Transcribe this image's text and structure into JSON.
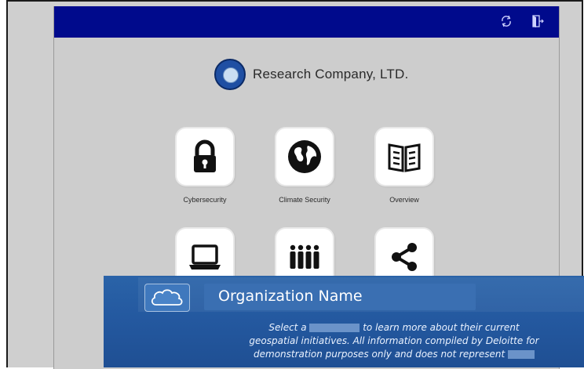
{
  "brand": {
    "name": "Research Company, LTD."
  },
  "toolbar": {
    "refresh_icon": "refresh-icon",
    "exit_icon": "exit-door-icon"
  },
  "tiles": [
    {
      "label": "Cybersecurity",
      "icon": "lock-icon"
    },
    {
      "label": "Climate Security",
      "icon": "globe-icon"
    },
    {
      "label": "Overview",
      "icon": "open-book-icon"
    },
    {
      "label": "",
      "icon": "laptop-icon"
    },
    {
      "label": "",
      "icon": "people-group-icon"
    },
    {
      "label": "",
      "icon": "share-icon"
    }
  ],
  "overlay": {
    "title": "Organization Name",
    "line1_a": "Select a",
    "line1_b": "to learn more about their current",
    "line2": "geospatial initiatives. All information compiled by Deloitte for",
    "line3": "demonstration purposes only and does not represent"
  },
  "colors": {
    "topbar": "#000a8c",
    "overlay": "#2459a0",
    "background": "#cdcdcd"
  }
}
